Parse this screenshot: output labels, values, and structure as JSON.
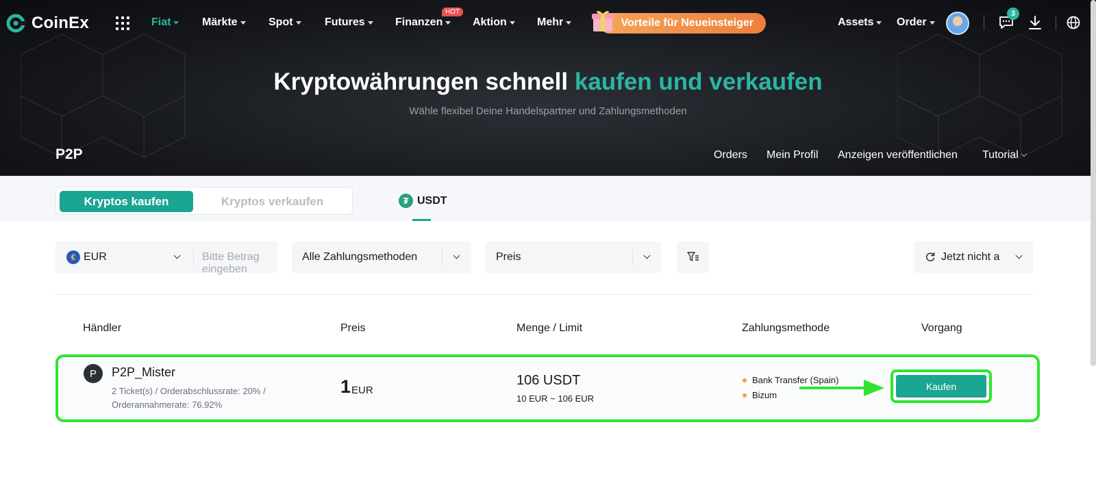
{
  "header": {
    "brand": "CoinEx",
    "nav": [
      {
        "label": "Fiat",
        "active": true
      },
      {
        "label": "Märkte"
      },
      {
        "label": "Spot"
      },
      {
        "label": "Futures"
      },
      {
        "label": "Finanzen",
        "badge": "HOT"
      },
      {
        "label": "Aktion"
      },
      {
        "label": "Mehr"
      }
    ],
    "promo": "Vorteile für Neueinsteiger",
    "assets": "Assets",
    "order": "Order",
    "message_count": "3"
  },
  "hero": {
    "title_plain": "Kryptowährungen schnell ",
    "title_accent": "kaufen und verkaufen",
    "subtitle": "Wähle flexibel Deine Handelspartner und Zahlungsmethoden"
  },
  "p2p": {
    "label": "P2P",
    "links": [
      "Orders",
      "Mein Profil",
      "Anzeigen veröffentlichen",
      "Tutorial"
    ]
  },
  "tabs": {
    "buy": "Kryptos kaufen",
    "sell": "Kryptos verkaufen",
    "coin": "USDT"
  },
  "filters": {
    "currency": "EUR",
    "amount_placeholder": "Bitte Betrag eingeben",
    "payment": "Alle Zahlungsmethoden",
    "sort": "Preis",
    "refresh": "Jetzt nicht a"
  },
  "table": {
    "headers": [
      "Händler",
      "Preis",
      "Menge / Limit",
      "Zahlungsmethode",
      "Vorgang"
    ],
    "rows": [
      {
        "initial": "P",
        "merchant": "P2P_Mister",
        "stats_line1": "2 Ticket(s) / Orderabschlussrate: 20% /",
        "stats_line2": "Orderannahmerate: 76.92%",
        "price": "1",
        "price_currency": "EUR",
        "quantity": "106 USDT",
        "limit": "10 EUR ~ 106 EUR",
        "payment_methods": [
          "Bank Transfer (Spain)",
          "Bizum"
        ],
        "action": "Kaufen"
      }
    ]
  },
  "colors": {
    "accent": "#1ba593",
    "highlight": "#2fe52f",
    "hero_bg": "#16181c"
  }
}
